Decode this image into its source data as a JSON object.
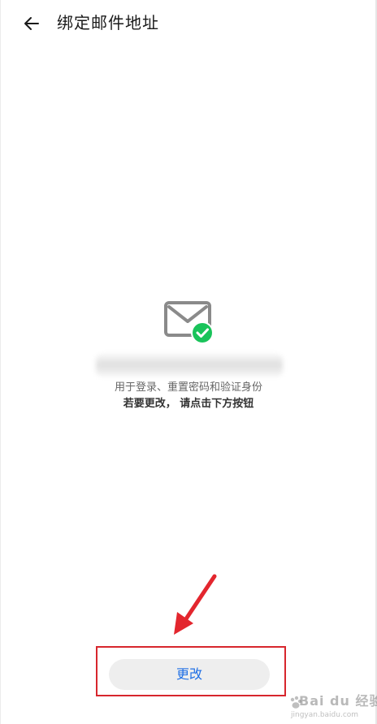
{
  "header": {
    "back_icon": "arrow-left-icon",
    "title": "绑定邮件地址"
  },
  "main": {
    "mail_icon": "mail-verified-icon",
    "email_masked": "",
    "desc_line1": "用于登录、重置密码和验证身份",
    "desc_line2": "若要更改， 请点击下方按钮"
  },
  "action": {
    "change_label": "更改"
  },
  "annotation": {
    "arrow_icon": "red-arrow-icon",
    "highlight_color": "#d7262d"
  },
  "watermark": {
    "brand": "Bai du 经验",
    "sub": "jingyan.baidu.com"
  },
  "colors": {
    "accent_blue": "#1f6fe5",
    "check_green": "#19c35a",
    "title_text": "#1a1a1a",
    "button_bg": "#eeeeee"
  }
}
